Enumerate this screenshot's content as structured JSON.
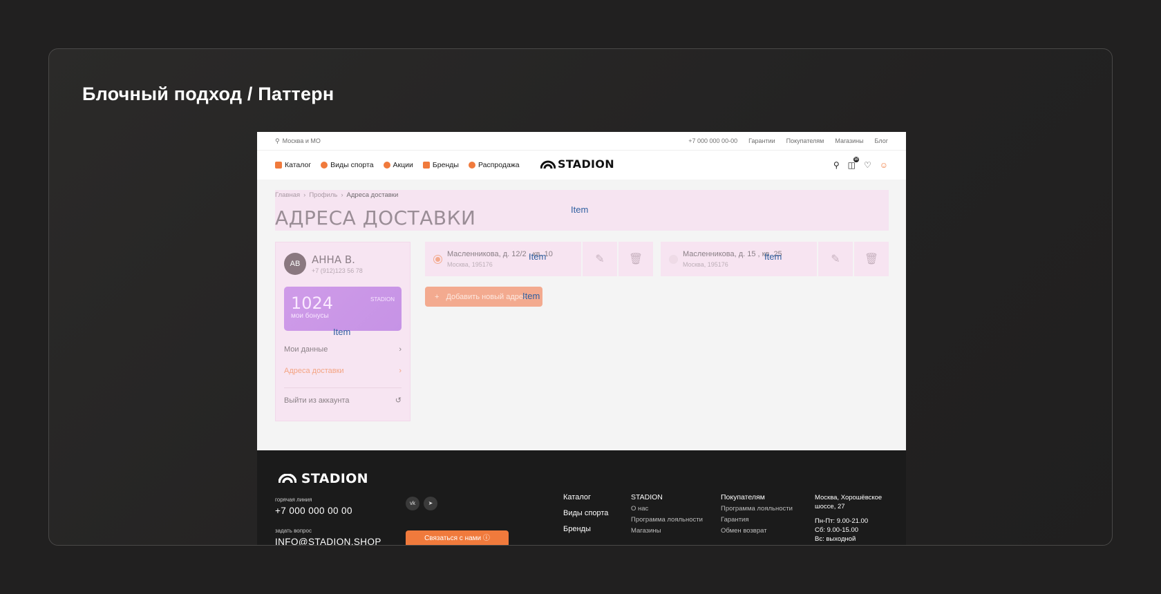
{
  "slide_title": "Блочный подход / Паттерн",
  "topbar": {
    "location": "Москва и МО",
    "phone": "+7 000 000 00-00",
    "links": [
      "Гарантии",
      "Покупателям",
      "Магазины",
      "Блог"
    ]
  },
  "nav": {
    "links": [
      "Каталог",
      "Виды спорта",
      "Акции",
      "Бренды",
      "Распродажа"
    ],
    "logo": "STADION",
    "cart_count": "10"
  },
  "breadcrumbs": [
    "Главная",
    "Профиль",
    "Адреса доставки"
  ],
  "page_title": "АДРЕСА ДОСТАВКИ",
  "overlay_label": "Item",
  "profile": {
    "initials": "АВ",
    "name": "АННА В.",
    "phone": "+7 (912)123 56 78",
    "bonus_value": "1024",
    "bonus_label": "мои бонусы",
    "bonus_logo": "STADION",
    "menu": [
      "Мои данные",
      "Адреса доставки",
      "Выйти из аккаунта"
    ]
  },
  "addresses": [
    {
      "line1": "Масленникова, д. 12/2 , кв. 10",
      "line2": "Москва, 195176",
      "selected": true
    },
    {
      "line1": "Масленникова, д. 15 , кв. 25",
      "line2": "Москва, 195176",
      "selected": false
    }
  ],
  "add_button": "Добавить новый адрес",
  "footer": {
    "logo": "STADION",
    "hotline_label": "горячая линия",
    "hotline": "+7 000 000 00 00",
    "ask_label": "задать вопрос",
    "email": "INFO@STADION.SHOP",
    "social": [
      "vk",
      "tg"
    ],
    "contact_button": "Связаться с нами",
    "col1": [
      "Каталог",
      "Виды спорта",
      "Бренды"
    ],
    "col2_title": "STADION",
    "col2": [
      "О нас",
      "Программа лояльности",
      "Магазины"
    ],
    "col3_title": "Покупателям",
    "col3": [
      "Программа лояльности",
      "Гарантия",
      "Обмен возврат"
    ],
    "address": "Москва, Хорошёвское шоссе, 27",
    "hours": [
      "Пн-Пт: 9.00-21.00",
      "Сб: 9.00-15.00",
      "Вс: выходной"
    ]
  },
  "colors": {
    "accent": "#f07a3c",
    "block_overlay": "#f6e4f1",
    "bonus_card": "#cf9be8",
    "footer_bg": "#1b1b1b"
  }
}
